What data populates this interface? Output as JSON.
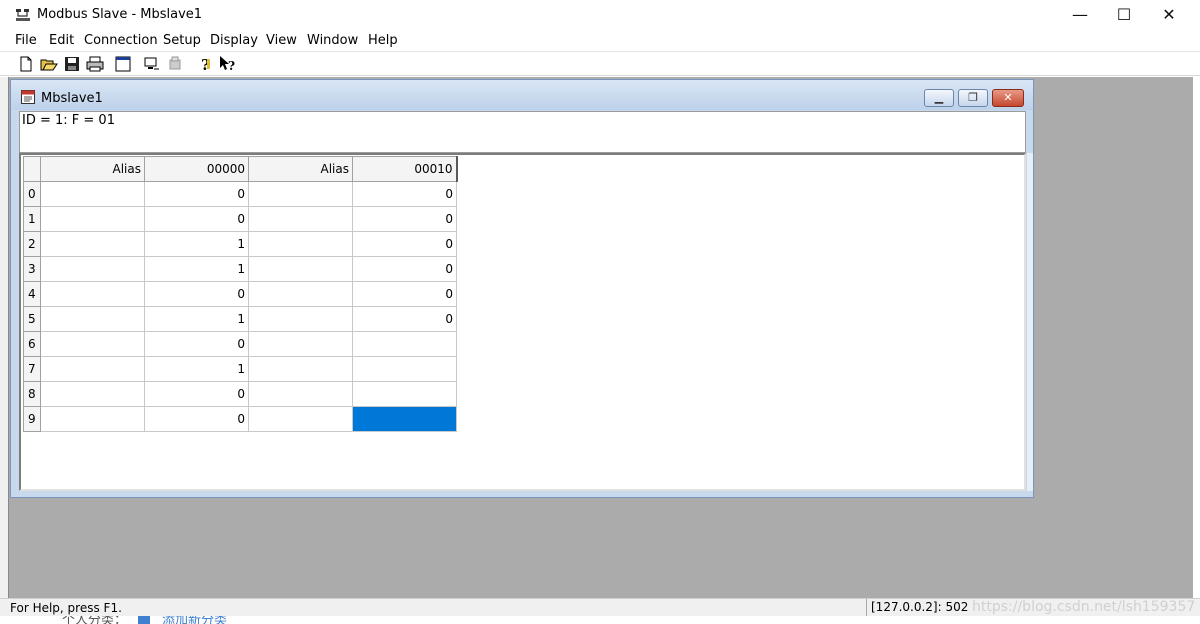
{
  "app": {
    "title": "Modbus Slave - Mbslave1",
    "window_buttons": {
      "minimize": "—",
      "maximize": "☐",
      "close": "✕"
    }
  },
  "menu": [
    "File",
    "Edit",
    "Connection",
    "Setup",
    "Display",
    "View",
    "Window",
    "Help"
  ],
  "toolbar": {
    "icons": [
      "new-icon",
      "open-icon",
      "save-icon",
      "print-icon",
      "window-icon",
      "connect-icon",
      "disconnect-icon",
      "help-icon",
      "context-help-icon"
    ]
  },
  "child": {
    "title": "Mbslave1",
    "info": "ID = 1: F = 01"
  },
  "grid": {
    "headers": [
      "Alias",
      "00000",
      "Alias",
      "00010"
    ],
    "rows": [
      {
        "idx": "0",
        "a1": "",
        "v1": "0",
        "a2": "",
        "v2": "0"
      },
      {
        "idx": "1",
        "a1": "",
        "v1": "0",
        "a2": "",
        "v2": "0"
      },
      {
        "idx": "2",
        "a1": "",
        "v1": "1",
        "a2": "",
        "v2": "0"
      },
      {
        "idx": "3",
        "a1": "",
        "v1": "1",
        "a2": "",
        "v2": "0"
      },
      {
        "idx": "4",
        "a1": "",
        "v1": "0",
        "a2": "",
        "v2": "0"
      },
      {
        "idx": "5",
        "a1": "",
        "v1": "1",
        "a2": "",
        "v2": "0"
      },
      {
        "idx": "6",
        "a1": "",
        "v1": "0",
        "a2": "",
        "v2": ""
      },
      {
        "idx": "7",
        "a1": "",
        "v1": "1",
        "a2": "",
        "v2": ""
      },
      {
        "idx": "8",
        "a1": "",
        "v1": "0",
        "a2": "",
        "v2": ""
      },
      {
        "idx": "9",
        "a1": "",
        "v1": "0",
        "a2": "",
        "v2": ""
      }
    ],
    "selected_color": "#0078d7"
  },
  "status": {
    "help": "For Help, press F1.",
    "connection": "[127.0.0.2]: 502",
    "watermark": "https://blog.csdn.net/lsh159357"
  },
  "background_page": {
    "category_label": "个人分类：",
    "add_link": "添加新分类"
  }
}
